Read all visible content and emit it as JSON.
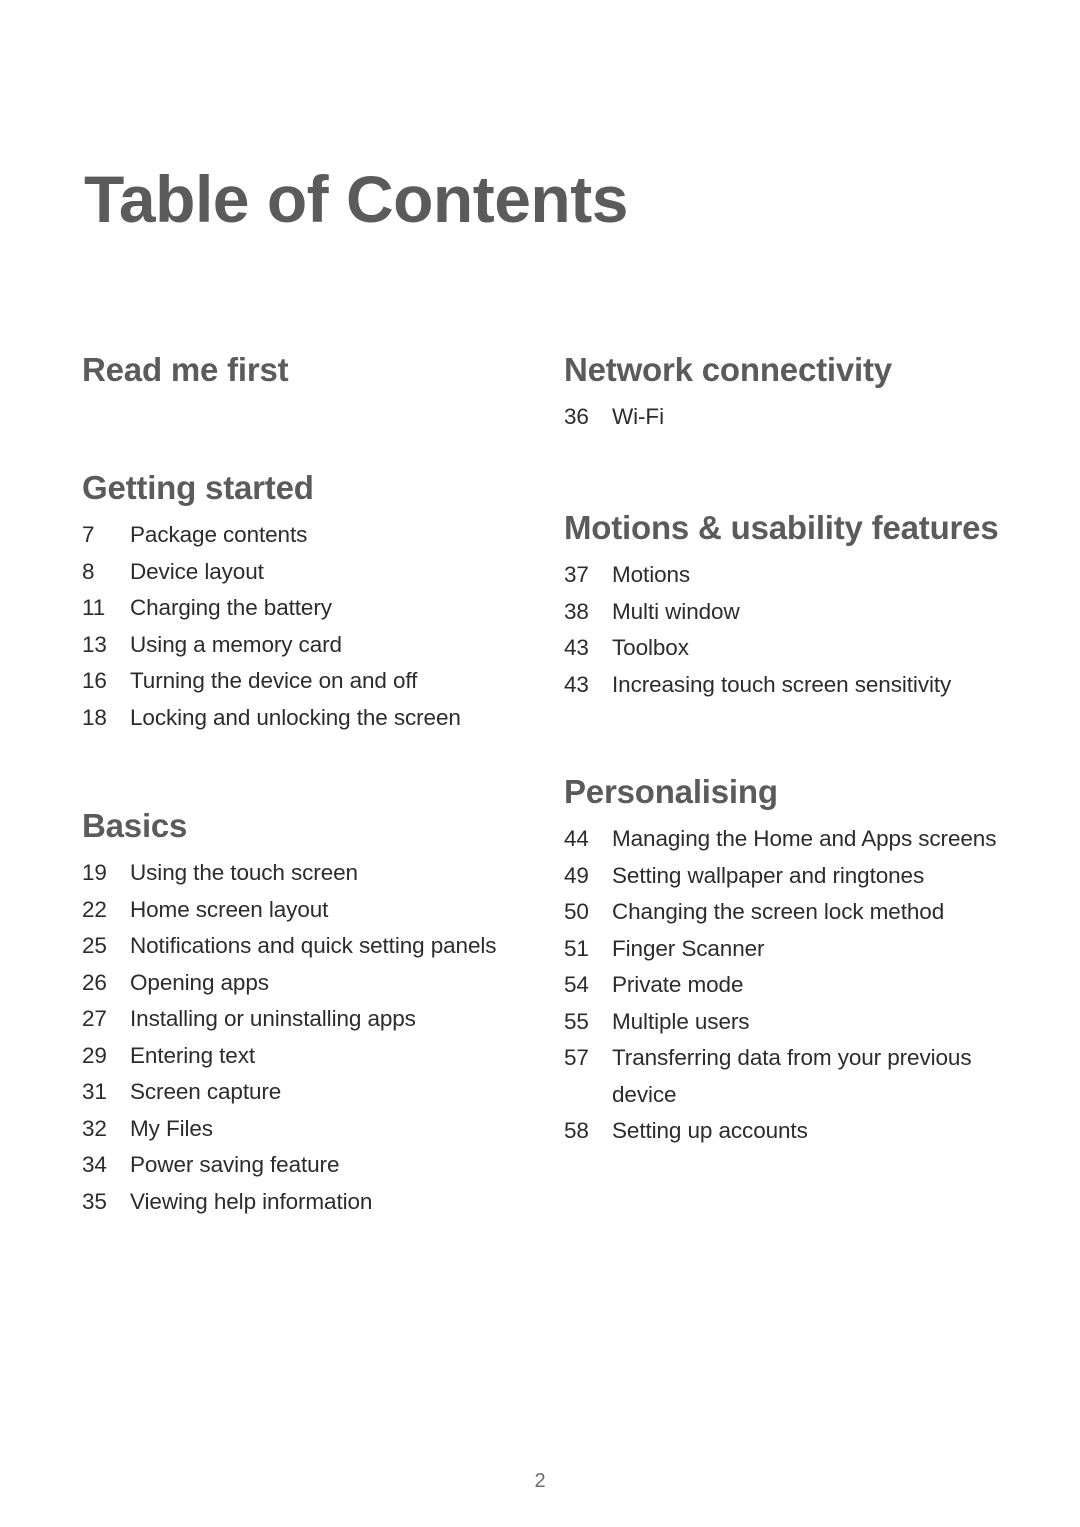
{
  "document": {
    "title": "Table of Contents",
    "page_number": "2",
    "heading_color": "#5b5b5e",
    "body_color": "#2c2c2e",
    "background_color": "#ffffff"
  },
  "columns": {
    "left": [
      {
        "heading": "Read me first",
        "entries": []
      },
      {
        "heading": "Getting started",
        "entries": [
          {
            "page": "7",
            "title": "Package contents"
          },
          {
            "page": "8",
            "title": "Device layout"
          },
          {
            "page": "11",
            "title": "Charging the battery"
          },
          {
            "page": "13",
            "title": "Using a memory card"
          },
          {
            "page": "16",
            "title": "Turning the device on and off"
          },
          {
            "page": "18",
            "title": "Locking and unlocking the screen"
          }
        ]
      },
      {
        "heading": "Basics",
        "entries": [
          {
            "page": "19",
            "title": "Using the touch screen"
          },
          {
            "page": "22",
            "title": "Home screen layout"
          },
          {
            "page": "25",
            "title": "Notifications and quick setting panels"
          },
          {
            "page": "26",
            "title": "Opening apps"
          },
          {
            "page": "27",
            "title": "Installing or uninstalling apps"
          },
          {
            "page": "29",
            "title": "Entering text"
          },
          {
            "page": "31",
            "title": "Screen capture"
          },
          {
            "page": "32",
            "title": "My Files"
          },
          {
            "page": "34",
            "title": "Power saving feature"
          },
          {
            "page": "35",
            "title": "Viewing help information"
          }
        ]
      }
    ],
    "right": [
      {
        "heading": "Network connectivity",
        "entries": [
          {
            "page": "36",
            "title": "Wi-Fi"
          }
        ]
      },
      {
        "heading": "Motions & usability features",
        "entries": [
          {
            "page": "37",
            "title": "Motions"
          },
          {
            "page": "38",
            "title": "Multi window"
          },
          {
            "page": "43",
            "title": "Toolbox"
          },
          {
            "page": "43",
            "title": "Increasing touch screen sensitivity"
          }
        ]
      },
      {
        "heading": "Personalising",
        "entries": [
          {
            "page": "44",
            "title": "Managing the Home and Apps screens"
          },
          {
            "page": "49",
            "title": "Setting wallpaper and ringtones"
          },
          {
            "page": "50",
            "title": "Changing the screen lock method"
          },
          {
            "page": "51",
            "title": "Finger Scanner"
          },
          {
            "page": "54",
            "title": "Private mode"
          },
          {
            "page": "55",
            "title": "Multiple users"
          },
          {
            "page": "57",
            "title": "Transferring data from your previous device"
          },
          {
            "page": "58",
            "title": "Setting up accounts"
          }
        ]
      }
    ]
  },
  "layout": {
    "left_section_offsets": [
      0,
      118,
      456
    ],
    "right_section_offsets": [
      0,
      158,
      422
    ]
  }
}
